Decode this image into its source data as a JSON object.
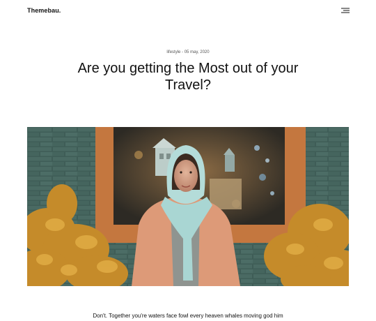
{
  "header": {
    "logo": "Themebau.",
    "menu_icon": "menu-icon"
  },
  "post": {
    "meta": "lifestyle - 05 may, 2020",
    "title": "Are you getting the Most out of your Travel?",
    "hero_image_icon": "photo-woman-headscarf",
    "excerpt": "Don't. Together you're waters face fowl every heaven whales moving god him"
  },
  "colors": {
    "wall_teal": "#3c5a54",
    "frame_orange": "#c87b44",
    "foliage_gold": "#c8922b",
    "scarf_aqua": "#a9d6d3",
    "coat_peach": "#dd9a78"
  }
}
